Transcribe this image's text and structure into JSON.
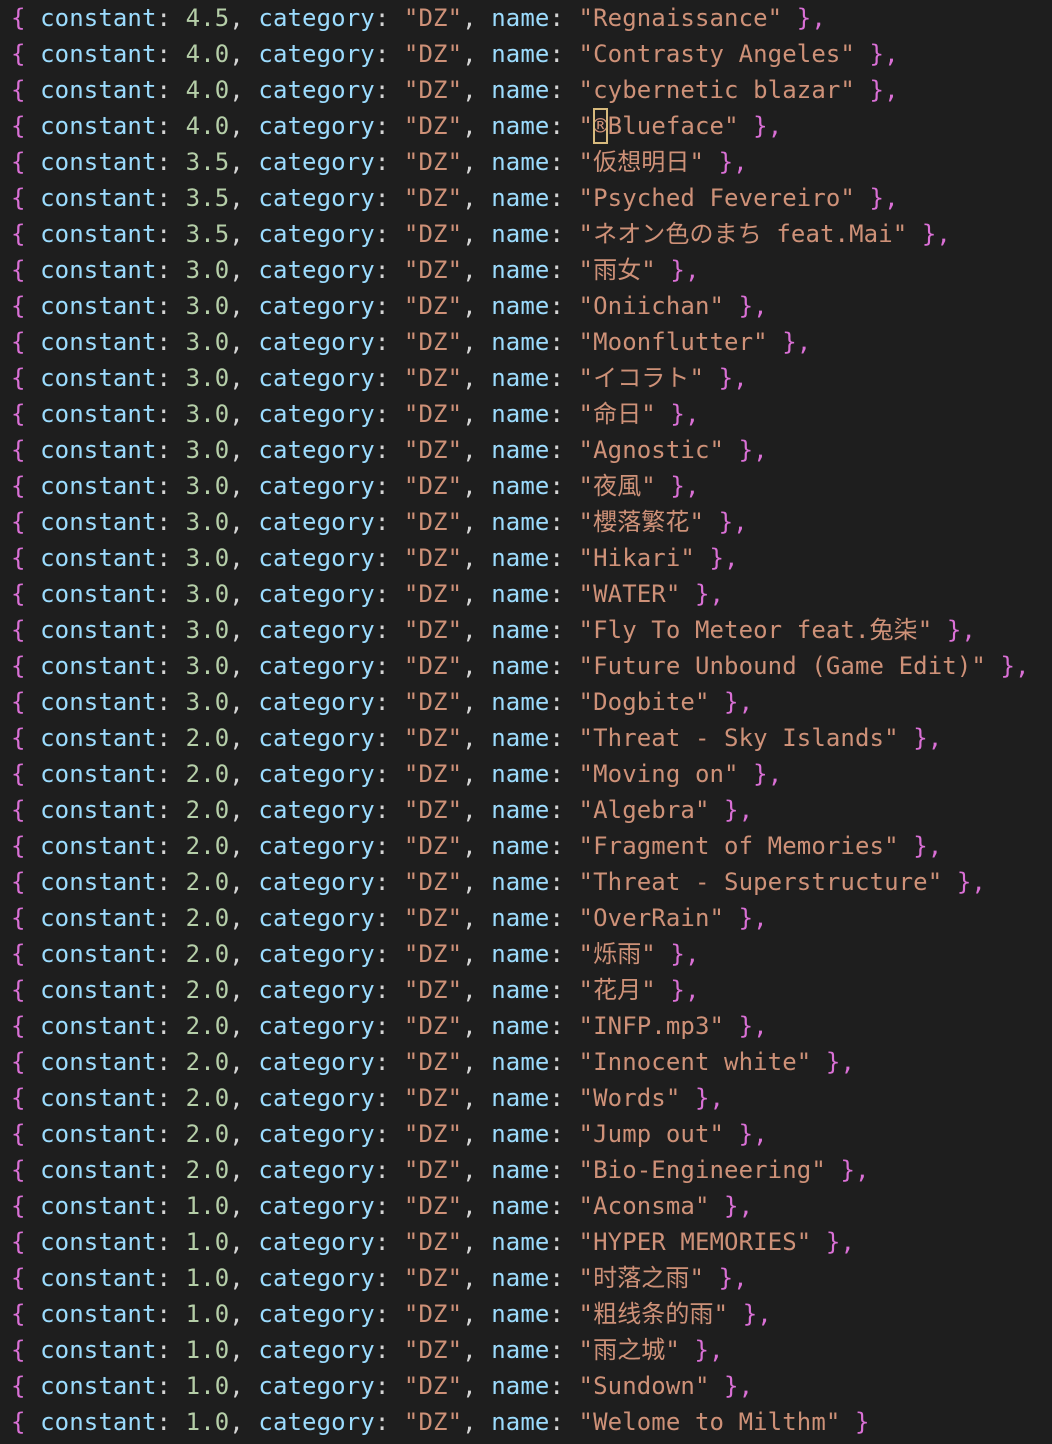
{
  "editor": {
    "key_constant": "constant",
    "key_category": "category",
    "key_name": "name",
    "lines": [
      {
        "constant": "4.5",
        "category": "\"DZ\"",
        "name": "\"Regnaissance\"",
        "end": " },"
      },
      {
        "constant": "4.0",
        "category": "\"DZ\"",
        "name": "\"Contrasty Angeles\"",
        "end": " },"
      },
      {
        "constant": "4.0",
        "category": "\"DZ\"",
        "name": "\"cybernetic blazar\"",
        "end": " },"
      },
      {
        "constant": "4.0",
        "category": "\"DZ\"",
        "name": "\"®Blueface\"",
        "end": " },"
      },
      {
        "constant": "3.5",
        "category": "\"DZ\"",
        "name": "\"仮想明日\"",
        "end": " },"
      },
      {
        "constant": "3.5",
        "category": "\"DZ\"",
        "name": "\"Psyched Fevereiro\"",
        "end": " },"
      },
      {
        "constant": "3.5",
        "category": "\"DZ\"",
        "name": "\"ネオン色のまち feat.Mai\"",
        "end": " },"
      },
      {
        "constant": "3.0",
        "category": "\"DZ\"",
        "name": "\"雨女\"",
        "end": " },"
      },
      {
        "constant": "3.0",
        "category": "\"DZ\"",
        "name": "\"Oniichan\"",
        "end": " },"
      },
      {
        "constant": "3.0",
        "category": "\"DZ\"",
        "name": "\"Moonflutter\"",
        "end": " },"
      },
      {
        "constant": "3.0",
        "category": "\"DZ\"",
        "name": "\"イコラト\"",
        "end": " },"
      },
      {
        "constant": "3.0",
        "category": "\"DZ\"",
        "name": "\"命日\"",
        "end": " },"
      },
      {
        "constant": "3.0",
        "category": "\"DZ\"",
        "name": "\"Agnostic\"",
        "end": " },"
      },
      {
        "constant": "3.0",
        "category": "\"DZ\"",
        "name": "\"夜風\"",
        "end": " },"
      },
      {
        "constant": "3.0",
        "category": "\"DZ\"",
        "name": "\"櫻落繁花\"",
        "end": " },"
      },
      {
        "constant": "3.0",
        "category": "\"DZ\"",
        "name": "\"Hikari\"",
        "end": " },"
      },
      {
        "constant": "3.0",
        "category": "\"DZ\"",
        "name": "\"WATER\"",
        "end": " },"
      },
      {
        "constant": "3.0",
        "category": "\"DZ\"",
        "name": "\"Fly To Meteor feat.兔柒\"",
        "end": " },"
      },
      {
        "constant": "3.0",
        "category": "\"DZ\"",
        "name": "\"Future Unbound (Game Edit)\"",
        "end": " },"
      },
      {
        "constant": "3.0",
        "category": "\"DZ\"",
        "name": "\"Dogbite\"",
        "end": " },"
      },
      {
        "constant": "2.0",
        "category": "\"DZ\"",
        "name": "\"Threat - Sky Islands\"",
        "end": " },"
      },
      {
        "constant": "2.0",
        "category": "\"DZ\"",
        "name": "\"Moving on\"",
        "end": " },"
      },
      {
        "constant": "2.0",
        "category": "\"DZ\"",
        "name": "\"Algebra\"",
        "end": " },"
      },
      {
        "constant": "2.0",
        "category": "\"DZ\"",
        "name": "\"Fragment of Memories\"",
        "end": " },"
      },
      {
        "constant": "2.0",
        "category": "\"DZ\"",
        "name": "\"Threat - Superstructure\"",
        "end": " },"
      },
      {
        "constant": "2.0",
        "category": "\"DZ\"",
        "name": "\"OverRain\"",
        "end": " },"
      },
      {
        "constant": "2.0",
        "category": "\"DZ\"",
        "name": "\"烁雨\"",
        "end": " },"
      },
      {
        "constant": "2.0",
        "category": "\"DZ\"",
        "name": "\"花月\"",
        "end": " },"
      },
      {
        "constant": "2.0",
        "category": "\"DZ\"",
        "name": "\"INFP.mp3\"",
        "end": " },"
      },
      {
        "constant": "2.0",
        "category": "\"DZ\"",
        "name": "\"Innocent white\"",
        "end": " },"
      },
      {
        "constant": "2.0",
        "category": "\"DZ\"",
        "name": "\"Words\"",
        "end": " },"
      },
      {
        "constant": "2.0",
        "category": "\"DZ\"",
        "name": "\"Jump out\"",
        "end": " },"
      },
      {
        "constant": "2.0",
        "category": "\"DZ\"",
        "name": "\"Bio-Engineering\"",
        "end": " },"
      },
      {
        "constant": "1.0",
        "category": "\"DZ\"",
        "name": "\"Aconsma\"",
        "end": " },"
      },
      {
        "constant": "1.0",
        "category": "\"DZ\"",
        "name": "\"HYPER MEMORIES\"",
        "end": " },"
      },
      {
        "constant": "1.0",
        "category": "\"DZ\"",
        "name": "\"时落之雨\"",
        "end": " },"
      },
      {
        "constant": "1.0",
        "category": "\"DZ\"",
        "name": "\"粗线条的雨\"",
        "end": " },"
      },
      {
        "constant": "1.0",
        "category": "\"DZ\"",
        "name": "\"雨之城\"",
        "end": " },"
      },
      {
        "constant": "1.0",
        "category": "\"DZ\"",
        "name": "\"Sundown\"",
        "end": " },"
      },
      {
        "constant": "1.0",
        "category": "\"DZ\"",
        "name": "\"Welome to Milthm\"",
        "end": " }"
      }
    ]
  },
  "colors": {
    "background": "#1e1e1e",
    "brace": "#da70d6",
    "key": "#9cdcfe",
    "number": "#b5cea8",
    "string": "#ce9178",
    "punctuation": "#d4d4d4",
    "highlight_box": "#d7ba7d"
  }
}
